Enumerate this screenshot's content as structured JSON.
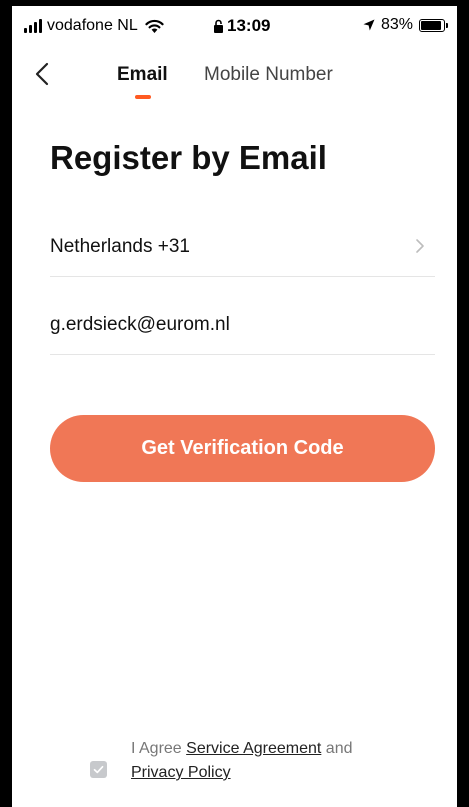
{
  "status_bar": {
    "carrier": "vodafone NL",
    "time": "13:09",
    "battery": "83%",
    "battery_level": 0.83
  },
  "nav": {
    "tabs": [
      {
        "label": "Email",
        "active": true
      },
      {
        "label": "Mobile Number",
        "active": false
      }
    ]
  },
  "page": {
    "title": "Register by Email"
  },
  "form": {
    "country": "Netherlands +31",
    "email_value": "g.erdsieck@eurom.nl",
    "submit_label": "Get Verification Code"
  },
  "agreement": {
    "prefix": "I Agree",
    "service_link": "Service Agreement",
    "conjunction": "and",
    "privacy_link": "Privacy Policy",
    "checked": true
  },
  "colors": {
    "accent": "#ff5a22",
    "button": "#f07756",
    "checkbox": "#c7c9cc"
  }
}
